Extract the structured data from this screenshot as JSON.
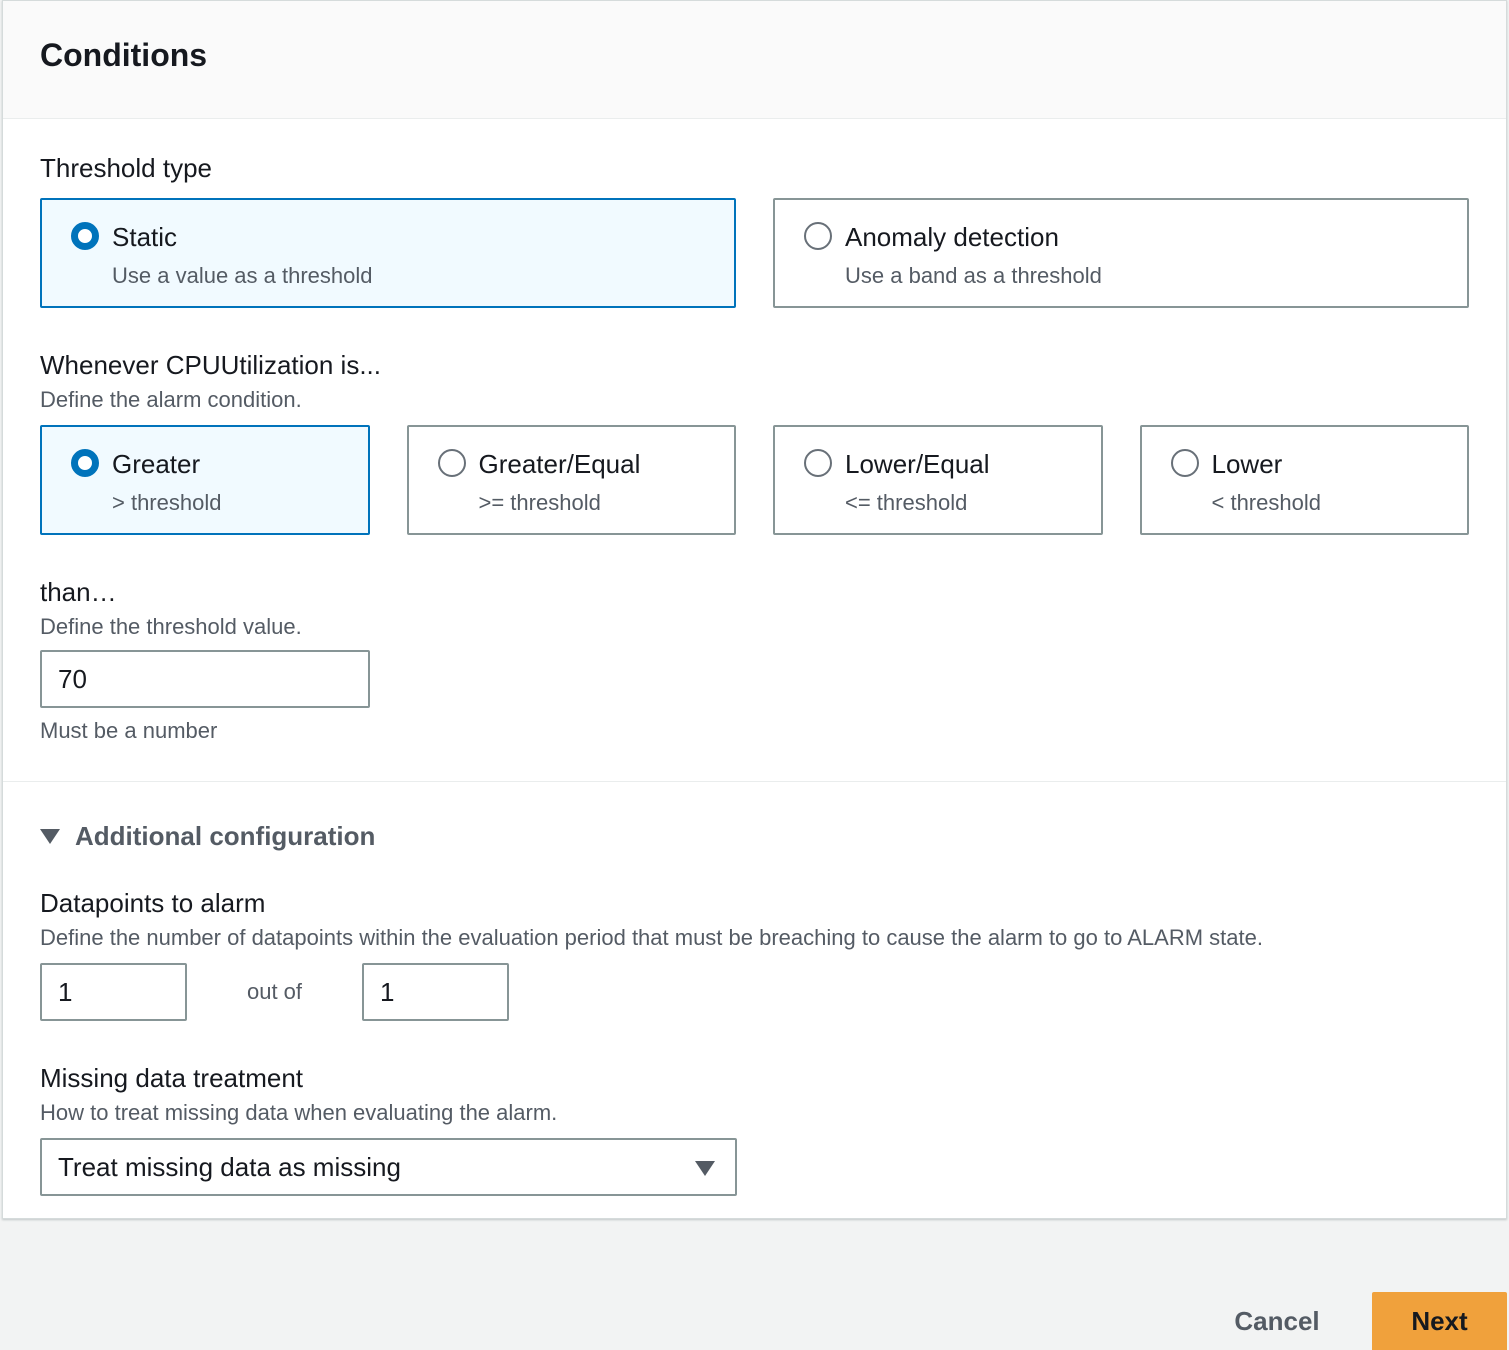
{
  "panel": {
    "title": "Conditions"
  },
  "threshold_type": {
    "label": "Threshold type",
    "options": [
      {
        "label": "Static",
        "desc": "Use a value as a threshold",
        "selected": true
      },
      {
        "label": "Anomaly detection",
        "desc": "Use a band as a threshold",
        "selected": false
      }
    ]
  },
  "condition": {
    "label": "Whenever CPUUtilization is...",
    "desc": "Define the alarm condition.",
    "options": [
      {
        "label": "Greater",
        "desc": "> threshold",
        "selected": true
      },
      {
        "label": "Greater/Equal",
        "desc": ">= threshold",
        "selected": false
      },
      {
        "label": "Lower/Equal",
        "desc": "<= threshold",
        "selected": false
      },
      {
        "label": "Lower",
        "desc": "< threshold",
        "selected": false
      }
    ]
  },
  "threshold": {
    "label": "than…",
    "desc": "Define the threshold value.",
    "value": "70",
    "hint": "Must be a number"
  },
  "additional": {
    "label": "Additional configuration",
    "datapoints": {
      "label": "Datapoints to alarm",
      "desc": "Define the number of datapoints within the evaluation period that must be breaching to cause the alarm to go to ALARM state.",
      "value": "1",
      "out_of_label": "out of",
      "out_of_value": "1"
    },
    "missing": {
      "label": "Missing data treatment",
      "desc": "How to treat missing data when evaluating the alarm.",
      "selected": "Treat missing data as missing"
    }
  },
  "footer": {
    "cancel_label": "Cancel",
    "next_label": "Next"
  },
  "colors": {
    "accent": "#0073bb",
    "primary_button": "#f0a13c"
  },
  "icons": {
    "radio_selected": "radio-selected-icon",
    "radio_unselected": "radio-unselected-icon",
    "caret": "caret-down-icon",
    "select_arrow": "dropdown-arrow-icon"
  }
}
